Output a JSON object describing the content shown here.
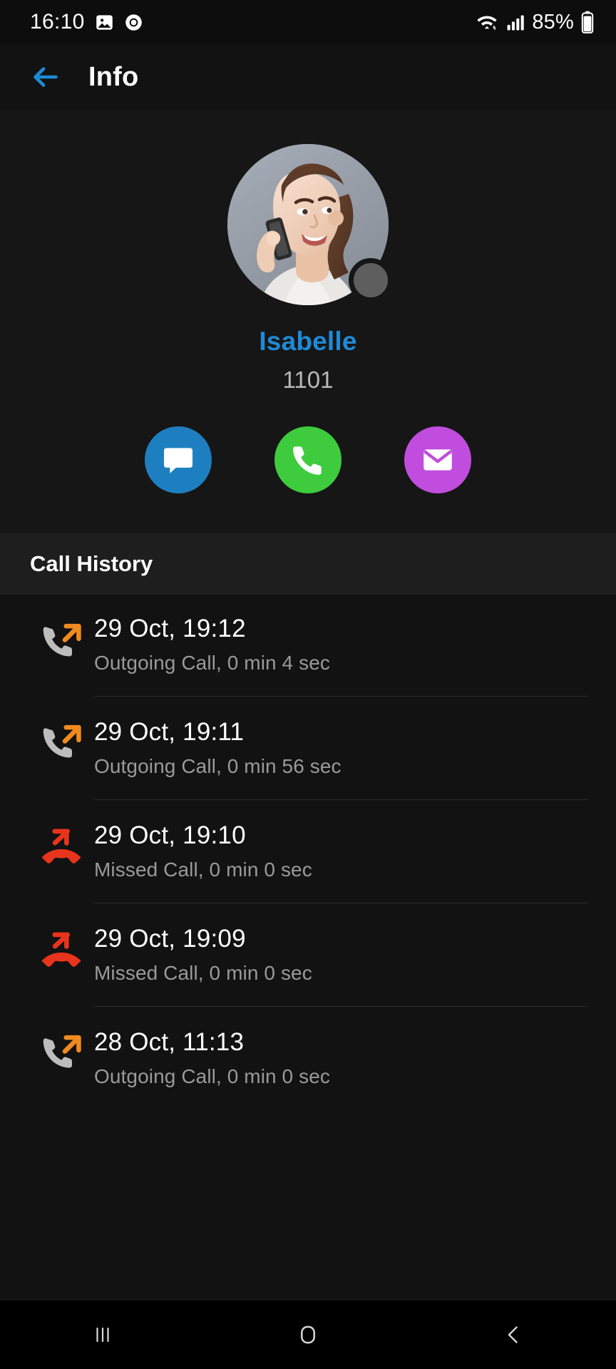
{
  "status_bar": {
    "time": "16:10",
    "left_icons": [
      "photo-icon",
      "app-icon"
    ],
    "right_icons": [
      "wifi-icon",
      "cellular-signal-icon"
    ],
    "battery_percent": "85%",
    "battery_icon": "battery-icon"
  },
  "app_bar": {
    "back_icon": "back-arrow-icon",
    "title": "Info",
    "accent_color": "#1e8ad6"
  },
  "profile": {
    "avatar_alt": "contact-photo",
    "presence": "offline",
    "presence_color": "#5e5e5e",
    "name": "Isabelle",
    "name_color": "#1e8ad6",
    "extension": "1101",
    "actions": [
      {
        "name": "message",
        "icon": "chat-bubble-icon",
        "color": "#1e7fc0"
      },
      {
        "name": "call",
        "icon": "phone-icon",
        "color": "#3ecb3e"
      },
      {
        "name": "email",
        "icon": "envelope-icon",
        "color": "#c04ddd"
      }
    ]
  },
  "call_history": {
    "header": "Call History",
    "items": [
      {
        "icon": "outgoing-call-icon",
        "type": "outgoing",
        "timestamp": "29 Oct, 19:12",
        "detail": "Outgoing Call, 0 min 4 sec"
      },
      {
        "icon": "outgoing-call-icon",
        "type": "outgoing",
        "timestamp": "29 Oct, 19:11",
        "detail": "Outgoing Call, 0 min 56 sec"
      },
      {
        "icon": "missed-call-icon",
        "type": "missed",
        "timestamp": "29 Oct, 19:10",
        "detail": "Missed Call, 0 min 0 sec"
      },
      {
        "icon": "missed-call-icon",
        "type": "missed",
        "timestamp": "29 Oct, 19:09",
        "detail": "Missed Call, 0 min 0 sec"
      },
      {
        "icon": "outgoing-call-icon",
        "type": "outgoing",
        "timestamp": "28 Oct, 11:13",
        "detail": "Outgoing Call, 0 min 0 sec"
      }
    ],
    "outgoing_color": "#f08a1e",
    "missed_color": "#e8341c"
  },
  "nav_bar": {
    "recents_icon": "recents-icon",
    "home_icon": "home-icon",
    "back_icon": "nav-back-icon"
  }
}
